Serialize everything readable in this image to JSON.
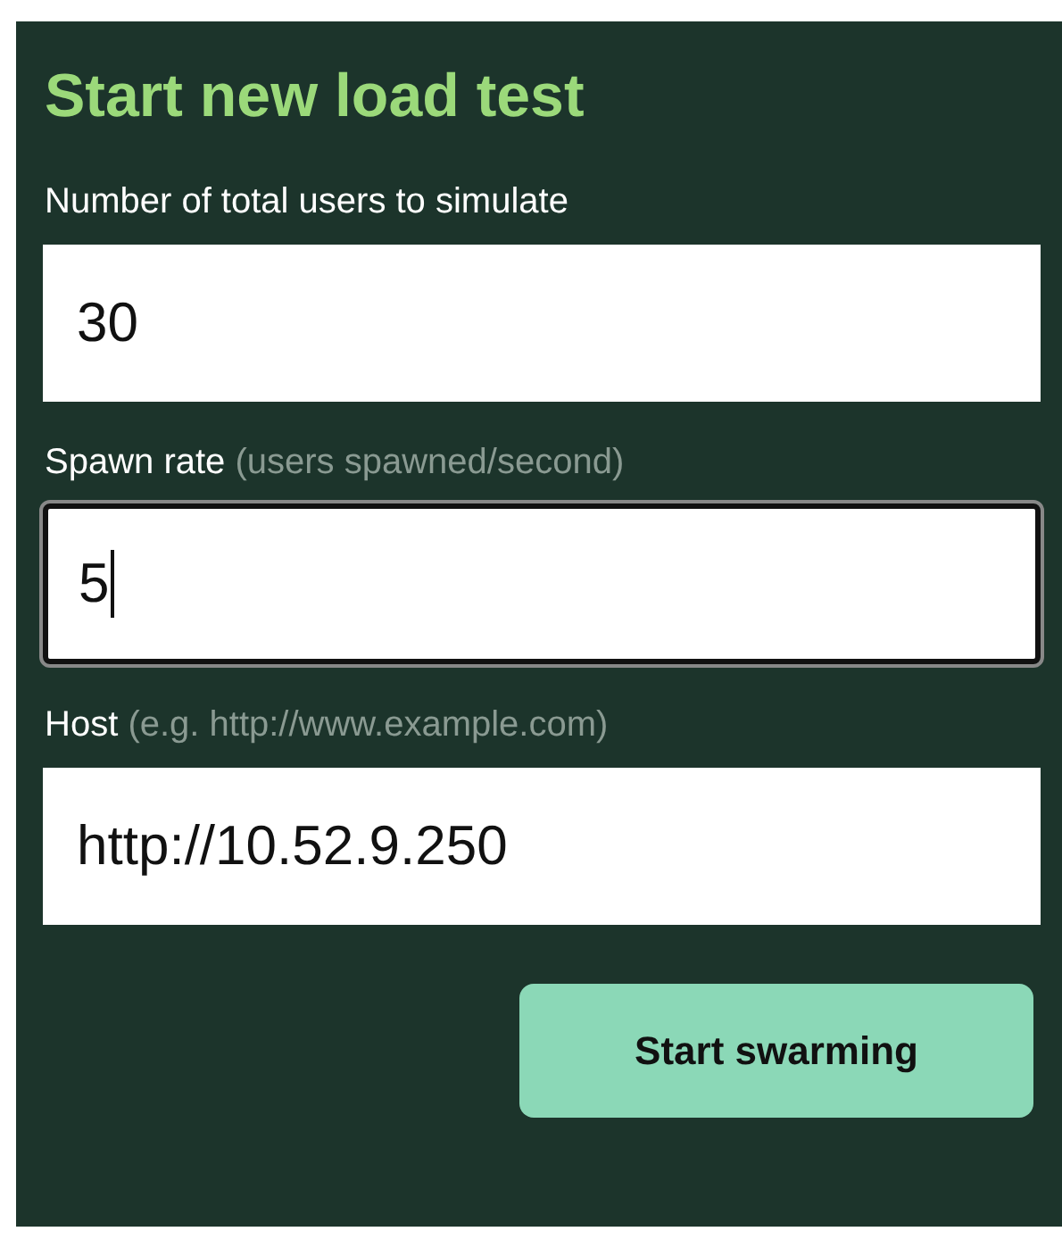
{
  "form": {
    "title": "Start new load test",
    "fields": [
      {
        "label": "Number of total users to simulate",
        "value": "30",
        "focused": false
      },
      {
        "label": "Spawn rate",
        "hint": "(users spawned/second)",
        "value": "5",
        "focused": true
      },
      {
        "label": "Host",
        "hint": "(e.g. http://www.example.com)",
        "value": "http://10.52.9.250",
        "focused": false
      }
    ],
    "button": "Start swarming"
  }
}
